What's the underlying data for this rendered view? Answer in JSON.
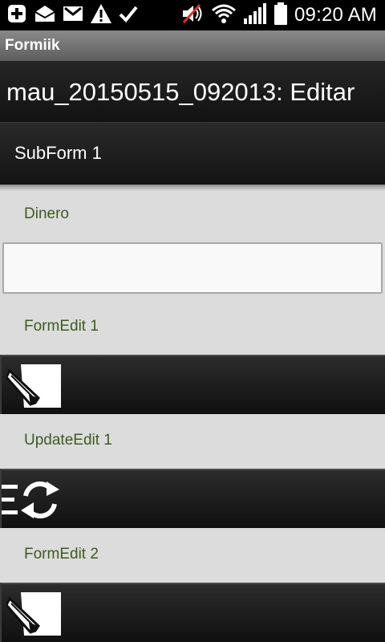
{
  "status_bar": {
    "time": "09:20 AM",
    "icons": [
      "plus-icon",
      "mail-icon",
      "gmail-icon",
      "warning-icon",
      "check-icon",
      "mute-icon",
      "wifi-icon",
      "signal-icon",
      "battery-icon"
    ]
  },
  "app": {
    "name": "Formiik"
  },
  "title": "mau_20150515_092013: Editar",
  "subform": {
    "label": "SubForm 1"
  },
  "fields": {
    "dinero": {
      "label": "Dinero",
      "value": "",
      "placeholder": ""
    },
    "form_edit_1": {
      "label": "FormEdit 1"
    },
    "update_edit_1": {
      "label": "UpdateEdit 1"
    },
    "form_edit_2": {
      "label": "FormEdit 2"
    }
  },
  "colors": {
    "label": "#3d5b21",
    "background": "#dcdcdc",
    "button_dark": "#1a1a1a"
  }
}
